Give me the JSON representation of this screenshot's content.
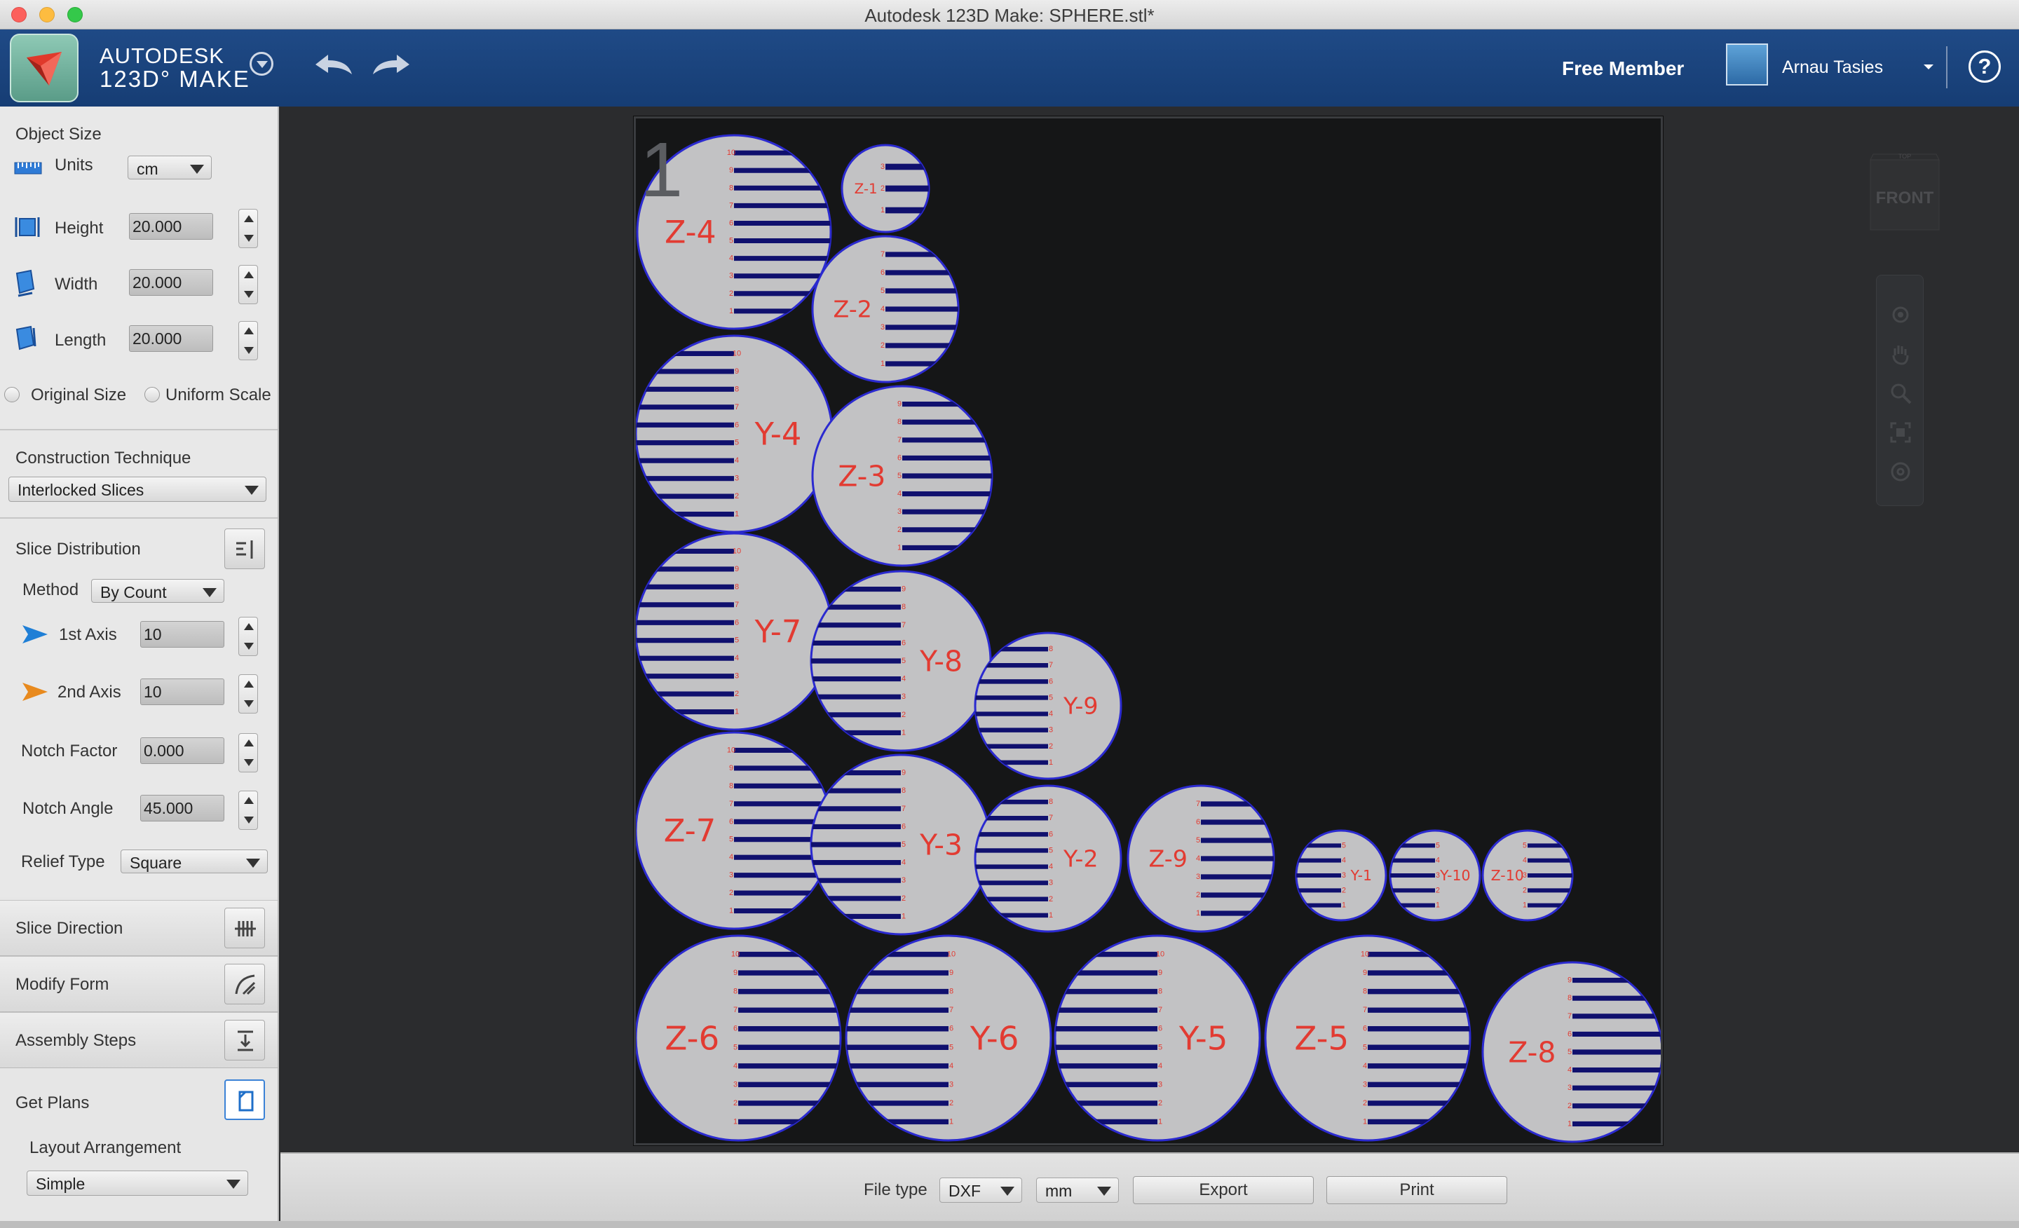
{
  "window": {
    "title": "Autodesk 123D Make: SPHERE.stl*"
  },
  "app": {
    "brand_top": "AUTODESK",
    "brand_bottom": "123D° MAKE",
    "member_status": "Free Member",
    "user_name": "Arnau Tasies",
    "help": "?"
  },
  "colors": {
    "header": "#1b4580",
    "canvas": "#2b2c2e",
    "slice_fill": "#c2c2c4",
    "slice_outline": "#2b2ad0",
    "slice_label": "#e23b32",
    "notch": "#10106e"
  },
  "object_size": {
    "title": "Object Size",
    "units_label": "Units",
    "units_value": "cm",
    "height_label": "Height",
    "height_value": "20.000",
    "width_label": "Width",
    "width_value": "20.000",
    "length_label": "Length",
    "length_value": "20.000",
    "original_size_label": "Original Size",
    "uniform_scale_label": "Uniform Scale"
  },
  "construction": {
    "title": "Construction Technique",
    "technique": "Interlocked Slices"
  },
  "slice_distribution": {
    "title": "Slice Distribution",
    "method_label": "Method",
    "method_value": "By Count",
    "axis1_label": "1st Axis",
    "axis1_value": "10",
    "axis2_label": "2nd Axis",
    "axis2_value": "10",
    "notch_factor_label": "Notch Factor",
    "notch_factor_value": "0.000",
    "notch_angle_label": "Notch Angle",
    "notch_angle_value": "45.000",
    "relief_type_label": "Relief Type",
    "relief_type_value": "Square"
  },
  "sections": {
    "slice_direction": "Slice Direction",
    "modify_form": "Modify Form",
    "assembly_steps": "Assembly Steps",
    "get_plans": "Get Plans"
  },
  "get_plans": {
    "layout_label": "Layout Arrangement",
    "layout_value": "Simple"
  },
  "canvas": {
    "sheet_number": "1",
    "viewcube_label": "FRONT",
    "viewcube_top": "TOP"
  },
  "bottom": {
    "file_type_label": "File type",
    "file_type_value": "DXF",
    "unit_value": "mm",
    "export_label": "Export",
    "print_label": "Print"
  },
  "slices": [
    {
      "label": "Z-4",
      "notch_side": "left",
      "ticks": 10
    },
    {
      "label": "Z-1",
      "notch_side": "left",
      "ticks": 3
    },
    {
      "label": "Z-2",
      "notch_side": "left",
      "ticks": 7
    },
    {
      "label": "Y-4",
      "notch_side": "right",
      "ticks": 10
    },
    {
      "label": "Z-3",
      "notch_side": "left",
      "ticks": 9
    },
    {
      "label": "Y-7",
      "notch_side": "right",
      "ticks": 10
    },
    {
      "label": "Y-8",
      "notch_side": "right",
      "ticks": 9
    },
    {
      "label": "Y-9",
      "notch_side": "right",
      "ticks": 8
    },
    {
      "label": "Z-7",
      "notch_side": "left",
      "ticks": 10
    },
    {
      "label": "Y-3",
      "notch_side": "right",
      "ticks": 9
    },
    {
      "label": "Y-2",
      "notch_side": "right",
      "ticks": 8
    },
    {
      "label": "Z-9",
      "notch_side": "left",
      "ticks": 7
    },
    {
      "label": "Y-1",
      "notch_side": "right",
      "ticks": 5
    },
    {
      "label": "Y-10",
      "notch_side": "right",
      "ticks": 5
    },
    {
      "label": "Z-10",
      "notch_side": "left",
      "ticks": 5
    },
    {
      "label": "Z-6",
      "notch_side": "left",
      "ticks": 10
    },
    {
      "label": "Y-6",
      "notch_side": "right",
      "ticks": 10
    },
    {
      "label": "Y-5",
      "notch_side": "right",
      "ticks": 10
    },
    {
      "label": "Z-5",
      "notch_side": "left",
      "ticks": 10
    },
    {
      "label": "Z-8",
      "notch_side": "left",
      "ticks": 9
    }
  ]
}
